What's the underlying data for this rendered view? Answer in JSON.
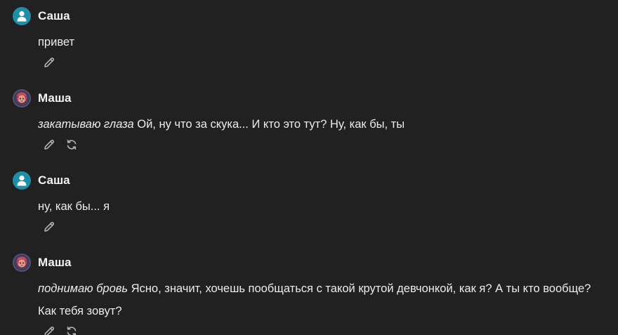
{
  "messages": [
    {
      "role": "user",
      "name": "Саша",
      "action": "",
      "text": "привет",
      "icons": [
        "edit-icon"
      ]
    },
    {
      "role": "bot",
      "name": "Маша",
      "action": "закатываю глаза",
      "text": " Ой, ну что за скука... И кто это тут? Ну, как бы, ты",
      "icons": [
        "edit-icon",
        "regenerate-icon"
      ]
    },
    {
      "role": "user",
      "name": "Саша",
      "action": "",
      "text": "ну, как бы... я",
      "icons": [
        "edit-icon"
      ]
    },
    {
      "role": "bot",
      "name": "Маша",
      "action": "поднимаю бровь",
      "text": " Ясно, значит, хочешь пообщаться с такой крутой девчонкой, как я? А ты кто вообще? Как тебя зовут?",
      "icons": [
        "edit-icon",
        "regenerate-icon"
      ]
    }
  ],
  "colors": {
    "background": "#212121",
    "user_avatar": "#1f8fa8",
    "bot_avatar": "#3b3550",
    "text": "#ececec",
    "icon": "#b4b4b4"
  }
}
